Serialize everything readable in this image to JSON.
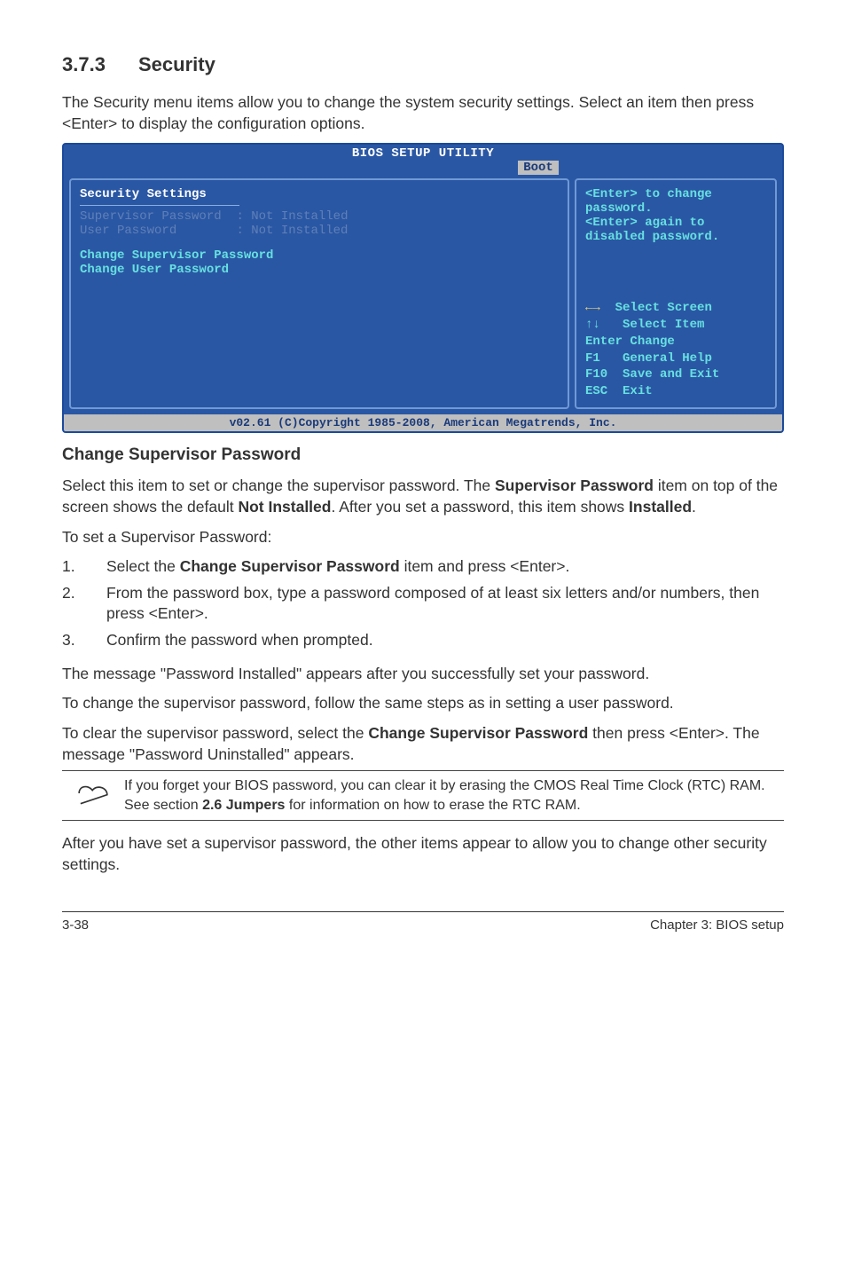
{
  "section": {
    "number": "3.7.3",
    "title": "Security",
    "intro": "The Security menu items allow you to change the system security settings. Select an item then press <Enter> to display the configuration options."
  },
  "bios": {
    "title": "BIOS SETUP UTILITY",
    "tab": "Boot",
    "left": {
      "heading": "Security Settings",
      "rows": [
        {
          "label": "Supervisor Password",
          "value": ": Not Installed"
        },
        {
          "label": "User Password",
          "value": ": Not Installed"
        }
      ],
      "items": [
        "Change Supervisor Password",
        "Change User Password"
      ]
    },
    "right": {
      "hint": "<Enter> to change password.\n<Enter> again to disabled password.",
      "keys": [
        {
          "sym": "←→",
          "label": "Select Screen",
          "yellow": true
        },
        {
          "sym": "↑↓",
          "label": "Select Item"
        },
        {
          "sym": "Enter",
          "label": "Change"
        },
        {
          "sym": "F1",
          "label": "General Help"
        },
        {
          "sym": "F10",
          "label": "Save and Exit"
        },
        {
          "sym": "ESC",
          "label": "Exit"
        }
      ]
    },
    "footer": "v02.61 (C)Copyright 1985-2008, American Megatrends, Inc."
  },
  "subheading": "Change Supervisor Password",
  "para1_a": "Select this item to set or change the supervisor password. The ",
  "para1_b": "Supervisor Password",
  "para1_c": " item on top of the screen shows the default ",
  "para1_d": "Not Installed",
  "para1_e": ". After you set a password, this item shows ",
  "para1_f": "Installed",
  "para1_g": ".",
  "para2": "To set a Supervisor Password:",
  "steps": [
    {
      "n": "1.",
      "a": "Select the ",
      "b": "Change Supervisor Password",
      "c": " item and press <Enter>."
    },
    {
      "n": "2.",
      "a": "From the password box, type a password composed of at least six letters and/or numbers, then press <Enter>.",
      "b": "",
      "c": ""
    },
    {
      "n": "3.",
      "a": "Confirm the password when prompted.",
      "b": "",
      "c": ""
    }
  ],
  "para3": "The message \"Password Installed\" appears after you successfully set your password.",
  "para4": "To change the supervisor password, follow the same steps as in setting a user password.",
  "para5_a": "To clear the supervisor password, select the ",
  "para5_b": "Change Supervisor Password",
  "para5_c": " then press <Enter>. The message \"Password Uninstalled\" appears.",
  "note_a": "If you forget your BIOS password, you can clear it by erasing the CMOS Real Time Clock (RTC) RAM. See section ",
  "note_b": "2.6 Jumpers",
  "note_c": " for information on how to erase the RTC RAM.",
  "para6": "After you have set a supervisor password, the other items appear to allow you to change other security settings.",
  "footer": {
    "left": "3-38",
    "right": "Chapter 3: BIOS setup"
  }
}
